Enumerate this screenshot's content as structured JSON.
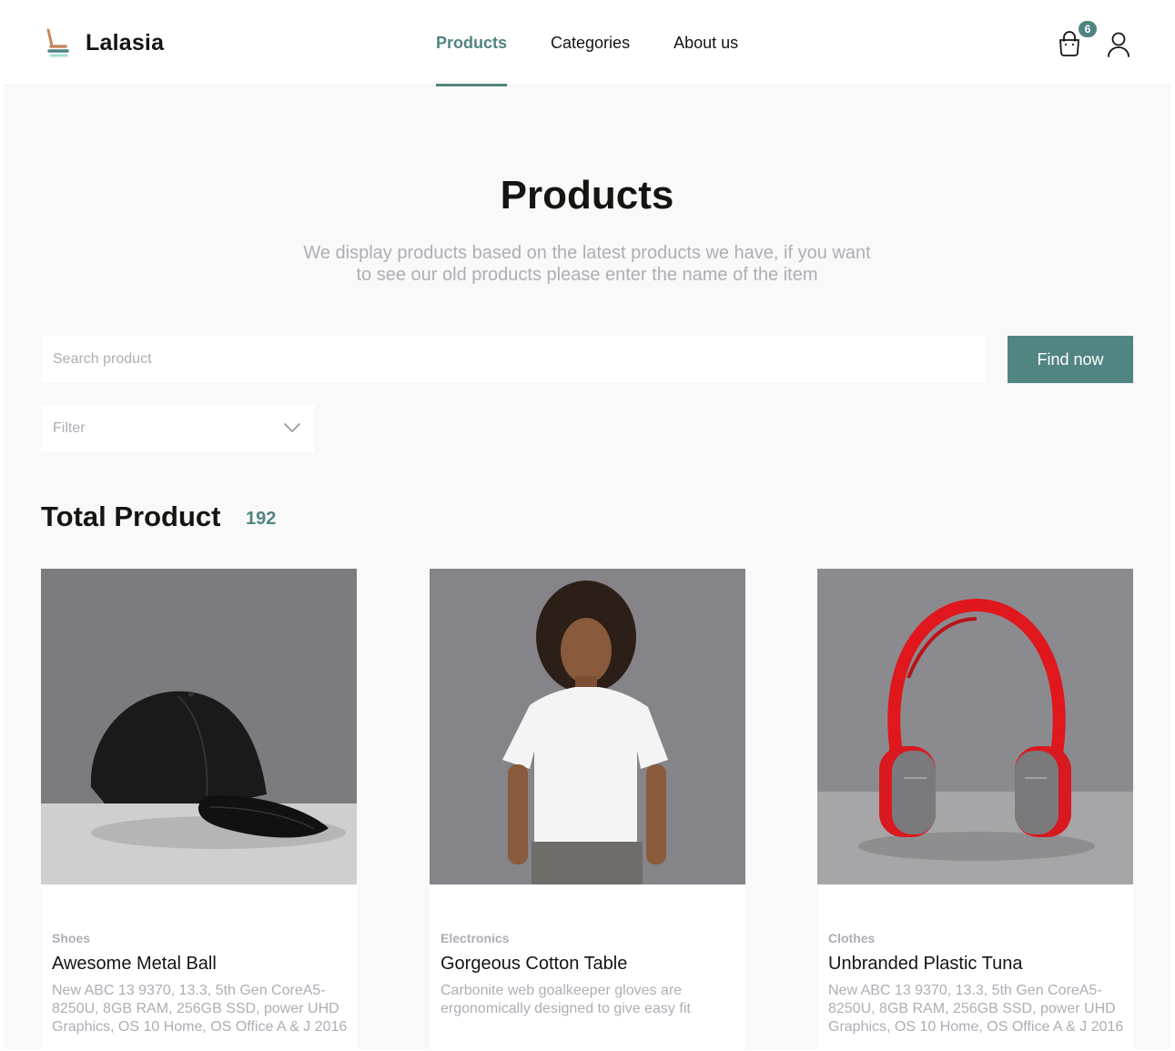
{
  "brand": {
    "name": "Lalasia"
  },
  "nav": {
    "items": [
      {
        "label": "Products",
        "active": true
      },
      {
        "label": "Categories",
        "active": false
      },
      {
        "label": "About us",
        "active": false
      }
    ]
  },
  "header": {
    "cart_count": "6",
    "cart_icon": "bag-icon",
    "user_icon": "user-icon"
  },
  "hero": {
    "title": "Products",
    "subtitle": "We display products based on the latest products we have, if you want to see our old products please enter the name of the item"
  },
  "search": {
    "placeholder": "Search product",
    "value": "",
    "button_label": "Find now"
  },
  "filter": {
    "label": "Filter"
  },
  "total": {
    "label": "Total Product",
    "count": "192"
  },
  "products": [
    {
      "category": "Shoes",
      "title": "Awesome Metal Ball",
      "description": "New ABC 13 9370, 13.3, 5th Gen CoreA5-8250U, 8GB RAM, 256GB SSD, power UHD Graphics, OS 10 Home, OS Office A & J 2016",
      "image": "black-cap"
    },
    {
      "category": "Electronics",
      "title": "Gorgeous Cotton Table",
      "description": "Carbonite web goalkeeper gloves are ergonomically designed to give easy fit",
      "image": "woman-white-tshirt"
    },
    {
      "category": "Clothes",
      "title": "Unbranded Plastic Tuna",
      "description": "New ABC 13 9370, 13.3, 5th Gen CoreA5-8250U, 8GB RAM, 256GB SSD, power UHD Graphics, OS 10 Home, OS Office A & J 2016",
      "image": "red-headphones"
    }
  ],
  "colors": {
    "accent": "#518581",
    "muted": "#afadb5",
    "text": "#151411",
    "background": "#f9f9f9"
  }
}
